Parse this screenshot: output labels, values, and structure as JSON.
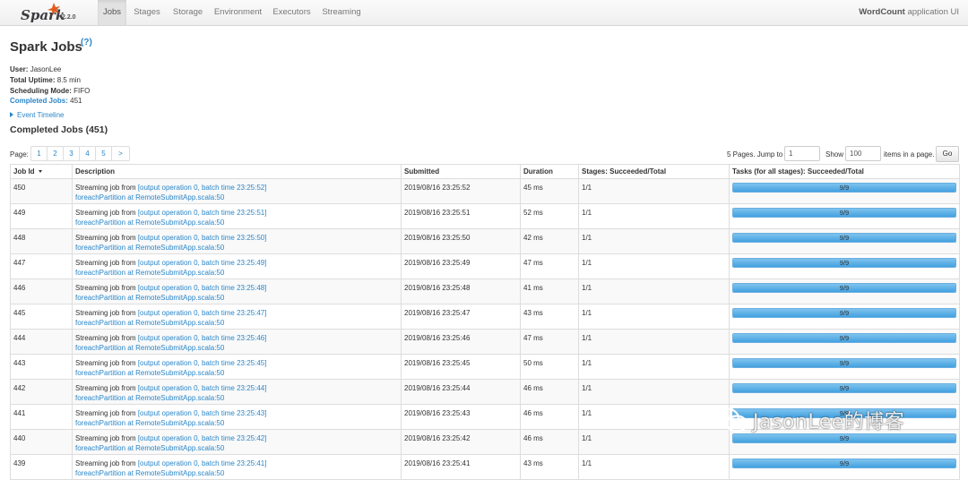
{
  "navbar": {
    "brand_version": "2.2.0",
    "tabs": [
      {
        "label": "Jobs",
        "active": true
      },
      {
        "label": "Stages",
        "active": false
      },
      {
        "label": "Storage",
        "active": false
      },
      {
        "label": "Environment",
        "active": false
      },
      {
        "label": "Executors",
        "active": false
      },
      {
        "label": "Streaming",
        "active": false
      }
    ],
    "app_name": "WordCount",
    "app_suffix": "application UI"
  },
  "header": {
    "title": "Spark Jobs",
    "help": "(?)"
  },
  "summary": {
    "user_label": "User:",
    "user": "JasonLee",
    "uptime_label": "Total Uptime:",
    "uptime": "8.5 min",
    "scheduling_label": "Scheduling Mode:",
    "scheduling": "FIFO",
    "completed_label": "Completed Jobs:",
    "completed": "451"
  },
  "event_timeline": "Event Timeline",
  "section_title": "Completed Jobs (451)",
  "paging": {
    "page_label": "Page:",
    "pages": [
      "1",
      "2",
      "3",
      "4",
      "5"
    ],
    "next": ">",
    "total_pages_text": "5 Pages. Jump to",
    "jump_value": "1",
    "show_label": "Show",
    "show_value": "100",
    "items_label": "items in a page.",
    "go": "Go"
  },
  "table": {
    "columns": [
      "Job Id",
      "Description",
      "Submitted",
      "Duration",
      "Stages: Succeeded/Total",
      "Tasks (for all stages): Succeeded/Total"
    ],
    "rows": [
      {
        "id": "450",
        "prefix": "Streaming job from ",
        "link": "[output operation 0, batch time 23:25:52]",
        "sub": "foreachPartition at RemoteSubmitApp.scala:50",
        "submitted": "2019/08/16 23:25:52",
        "duration": "45 ms",
        "stages": "1/1",
        "tasks": "9/9",
        "progress": 1.0
      },
      {
        "id": "449",
        "prefix": "Streaming job from ",
        "link": "[output operation 0, batch time 23:25:51]",
        "sub": "foreachPartition at RemoteSubmitApp.scala:50",
        "submitted": "2019/08/16 23:25:51",
        "duration": "52 ms",
        "stages": "1/1",
        "tasks": "9/9",
        "progress": 1.0
      },
      {
        "id": "448",
        "prefix": "Streaming job from ",
        "link": "[output operation 0, batch time 23:25:50]",
        "sub": "foreachPartition at RemoteSubmitApp.scala:50",
        "submitted": "2019/08/16 23:25:50",
        "duration": "42 ms",
        "stages": "1/1",
        "tasks": "9/9",
        "progress": 1.0
      },
      {
        "id": "447",
        "prefix": "Streaming job from ",
        "link": "[output operation 0, batch time 23:25:49]",
        "sub": "foreachPartition at RemoteSubmitApp.scala:50",
        "submitted": "2019/08/16 23:25:49",
        "duration": "47 ms",
        "stages": "1/1",
        "tasks": "9/9",
        "progress": 1.0
      },
      {
        "id": "446",
        "prefix": "Streaming job from ",
        "link": "[output operation 0, batch time 23:25:48]",
        "sub": "foreachPartition at RemoteSubmitApp.scala:50",
        "submitted": "2019/08/16 23:25:48",
        "duration": "41 ms",
        "stages": "1/1",
        "tasks": "9/9",
        "progress": 1.0
      },
      {
        "id": "445",
        "prefix": "Streaming job from ",
        "link": "[output operation 0, batch time 23:25:47]",
        "sub": "foreachPartition at RemoteSubmitApp.scala:50",
        "submitted": "2019/08/16 23:25:47",
        "duration": "43 ms",
        "stages": "1/1",
        "tasks": "9/9",
        "progress": 1.0
      },
      {
        "id": "444",
        "prefix": "Streaming job from ",
        "link": "[output operation 0, batch time 23:25:46]",
        "sub": "foreachPartition at RemoteSubmitApp.scala:50",
        "submitted": "2019/08/16 23:25:46",
        "duration": "47 ms",
        "stages": "1/1",
        "tasks": "9/9",
        "progress": 1.0
      },
      {
        "id": "443",
        "prefix": "Streaming job from ",
        "link": "[output operation 0, batch time 23:25:45]",
        "sub": "foreachPartition at RemoteSubmitApp.scala:50",
        "submitted": "2019/08/16 23:25:45",
        "duration": "50 ms",
        "stages": "1/1",
        "tasks": "9/9",
        "progress": 1.0
      },
      {
        "id": "442",
        "prefix": "Streaming job from ",
        "link": "[output operation 0, batch time 23:25:44]",
        "sub": "foreachPartition at RemoteSubmitApp.scala:50",
        "submitted": "2019/08/16 23:25:44",
        "duration": "46 ms",
        "stages": "1/1",
        "tasks": "9/9",
        "progress": 1.0
      },
      {
        "id": "441",
        "prefix": "Streaming job from ",
        "link": "[output operation 0, batch time 23:25:43]",
        "sub": "foreachPartition at RemoteSubmitApp.scala:50",
        "submitted": "2019/08/16 23:25:43",
        "duration": "46 ms",
        "stages": "1/1",
        "tasks": "9/9",
        "progress": 1.0
      },
      {
        "id": "440",
        "prefix": "Streaming job from ",
        "link": "[output operation 0, batch time 23:25:42]",
        "sub": "foreachPartition at RemoteSubmitApp.scala:50",
        "submitted": "2019/08/16 23:25:42",
        "duration": "46 ms",
        "stages": "1/1",
        "tasks": "9/9",
        "progress": 1.0
      },
      {
        "id": "439",
        "prefix": "Streaming job from ",
        "link": "[output operation 0, batch time 23:25:41]",
        "sub": "foreachPartition at RemoteSubmitApp.scala:50",
        "submitted": "2019/08/16 23:25:41",
        "duration": "43 ms",
        "stages": "1/1",
        "tasks": "9/9",
        "progress": 1.0
      }
    ]
  },
  "watermark": {
    "text": "JasonLee的博客",
    "icon": "wechat-icon"
  },
  "colors": {
    "link": "#2a86c8",
    "progress": "#5aa9e6",
    "spark_orange": "#e25a1c"
  }
}
